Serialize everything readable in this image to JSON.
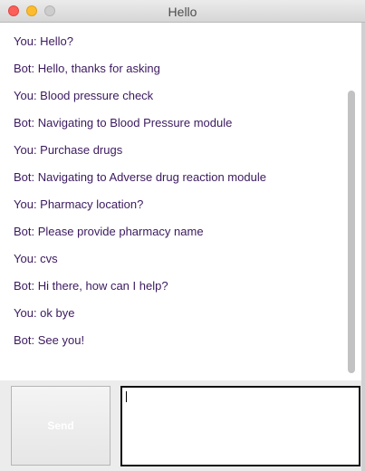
{
  "window": {
    "title": "Hello"
  },
  "chat": {
    "messages": [
      "You: Hello?",
      "Bot: Hello, thanks for asking",
      "You: Blood pressure check",
      "Bot: Navigating to Blood Pressure module",
      "You: Purchase drugs",
      "Bot: Navigating to Adverse drug reaction module",
      "You: Pharmacy location?",
      "Bot: Please provide pharmacy name",
      "You: cvs",
      "Bot: Hi there, how can I help?",
      "You: ok bye",
      "Bot: See you!"
    ]
  },
  "composer": {
    "send_label": "Send",
    "input_value": ""
  }
}
